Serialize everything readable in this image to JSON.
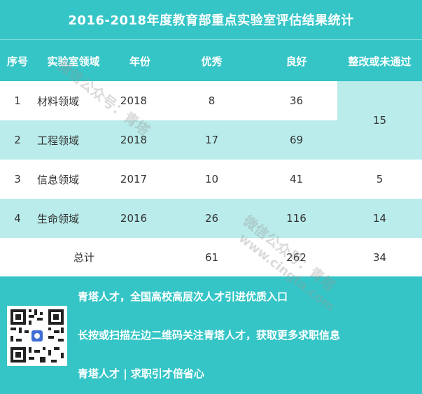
{
  "title": "2016-2018年度教育部重点实验室评估结果统计",
  "headers": [
    "序号",
    "实验室领域",
    "年份",
    "优秀",
    "良好",
    "整改或未通过"
  ],
  "rows": [
    {
      "no": "1",
      "field": "材料领域",
      "year": "2018",
      "excellent": "8",
      "good": "36"
    },
    {
      "no": "2",
      "field": "工程领域",
      "year": "2018",
      "excellent": "17",
      "good": "69"
    },
    {
      "no": "3",
      "field": "信息领域",
      "year": "2017",
      "excellent": "10",
      "good": "41",
      "fail": "5"
    },
    {
      "no": "4",
      "field": "生命领域",
      "year": "2016",
      "excellent": "26",
      "good": "116",
      "fail": "14"
    }
  ],
  "merged_fail_rows_1_2": "15",
  "total": {
    "label": "总计",
    "excellent": "61",
    "good": "262",
    "fail": "34"
  },
  "footer": {
    "line1": "青塔人才，全国高校高层次人才引进优质入口",
    "line2": "长按或扫描左边二维码关注青塔人才，获取更多求职信息",
    "line3": "青塔人才 | 求职引才倍省心"
  },
  "watermarks": {
    "wm1": "微信公众号：青塔",
    "wm2": "www.cingta.com"
  },
  "colors": {
    "primary": "#35c5c7",
    "stripe": "#b9ecea"
  }
}
